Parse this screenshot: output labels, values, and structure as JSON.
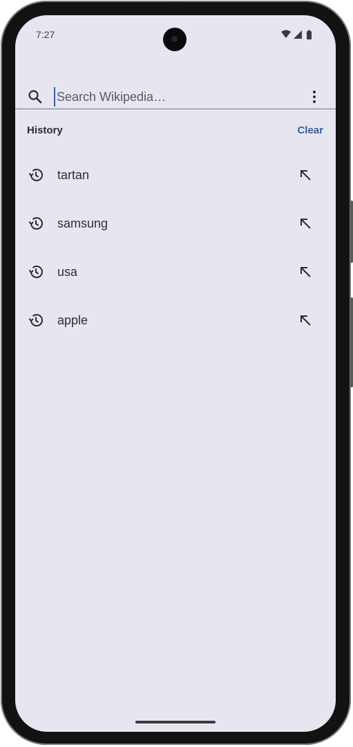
{
  "status_bar": {
    "time": "7:27"
  },
  "search": {
    "placeholder": "Search Wikipedia…",
    "value": ""
  },
  "history": {
    "title": "History",
    "clear_label": "Clear",
    "items": [
      {
        "label": "tartan"
      },
      {
        "label": "samsung"
      },
      {
        "label": "usa"
      },
      {
        "label": "apple"
      }
    ]
  },
  "colors": {
    "background": "#e7e6f0",
    "accent": "#3a5a9f",
    "text": "#2e2e37"
  },
  "icons": {
    "search": "search-icon",
    "more": "more-vert-icon",
    "history": "history-icon",
    "fill_query": "arrow-up-left-icon"
  }
}
